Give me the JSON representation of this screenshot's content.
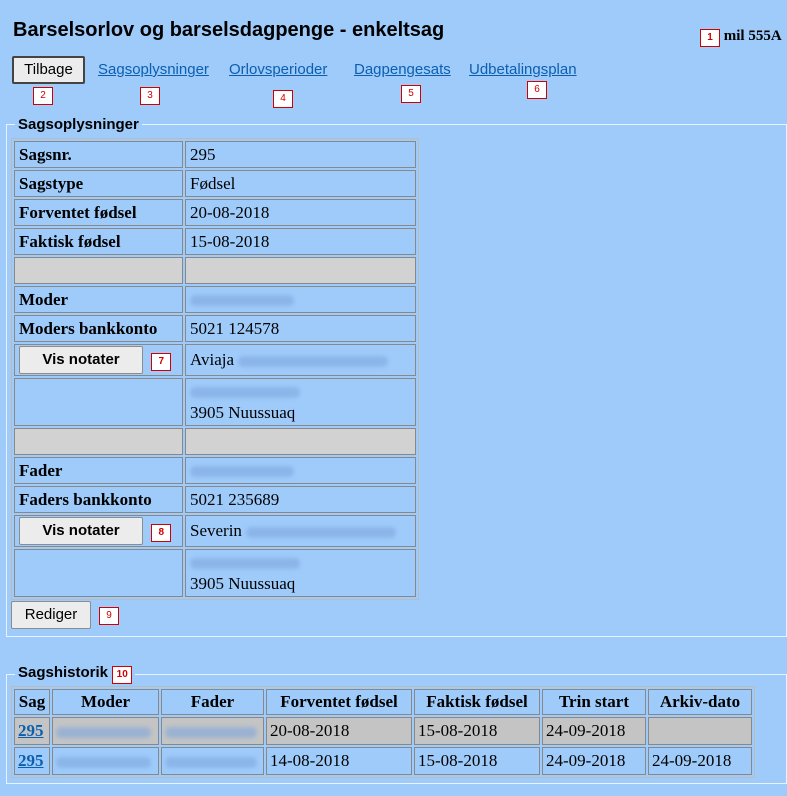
{
  "header": {
    "title": "Barselsorlov og barselsdagpenge - enkeltsag",
    "user_code": "mil 555A"
  },
  "markers": [
    "1",
    "2",
    "3",
    "4",
    "5",
    "6",
    "7",
    "8",
    "9",
    "10"
  ],
  "nav": {
    "back_label": "Tilbage",
    "links": [
      "Sagsoplysninger",
      "Orlovsperioder",
      "Dagpengesats",
      "Udbetalingsplan"
    ]
  },
  "case_info": {
    "legend": "Sagsoplysninger",
    "rows": [
      {
        "label": "Sagsnr.",
        "value": "295"
      },
      {
        "label": "Sagstype",
        "value": "Fødsel"
      },
      {
        "label": "Forventet fødsel",
        "value": "20-08-2018"
      },
      {
        "label": "Faktisk fødsel",
        "value": "15-08-2018"
      }
    ],
    "mother": {
      "label": "Moder",
      "bank_label": "Moders bankkonto",
      "bank_value": "5021 124578",
      "notes_button": "Vis notater",
      "first_name": "Aviaja",
      "city": "3905 Nuussuaq"
    },
    "father": {
      "label": "Fader",
      "bank_label": "Faders bankkonto",
      "bank_value": "5021 235689",
      "notes_button": "Vis notater",
      "first_name": "Severin",
      "city": "3905 Nuussuaq"
    },
    "edit_button": "Rediger"
  },
  "history": {
    "legend": "Sagshistorik",
    "columns": [
      "Sag",
      "Moder",
      "Fader",
      "Forventet fødsel",
      "Faktisk fødsel",
      "Trin start",
      "Arkiv-dato"
    ],
    "rows": [
      {
        "sag": "295",
        "forventet": "20-08-2018",
        "faktisk": "15-08-2018",
        "trin_start": "24-09-2018",
        "arkiv": ""
      },
      {
        "sag": "295",
        "forventet": "14-08-2018",
        "faktisk": "15-08-2018",
        "trin_start": "24-09-2018",
        "arkiv": "24-09-2018"
      }
    ]
  },
  "colors": {
    "background": "#9fcbfb",
    "link": "#0b5fb0",
    "marker": "#d00000"
  }
}
